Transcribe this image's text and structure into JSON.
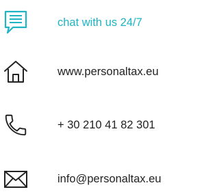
{
  "colors": {
    "accent": "#1eb4c4",
    "text": "#222222",
    "icon": "#222222"
  },
  "contacts": [
    {
      "icon": "chat-icon",
      "text": "chat with us 24/7",
      "highlight": true
    },
    {
      "icon": "home-icon",
      "text": "www.personaltax.eu",
      "highlight": false
    },
    {
      "icon": "phone-icon",
      "text": "+ 30 210 41 82 301",
      "highlight": false
    },
    {
      "icon": "mail-icon",
      "text": "info@personaltax.eu",
      "highlight": false
    }
  ]
}
